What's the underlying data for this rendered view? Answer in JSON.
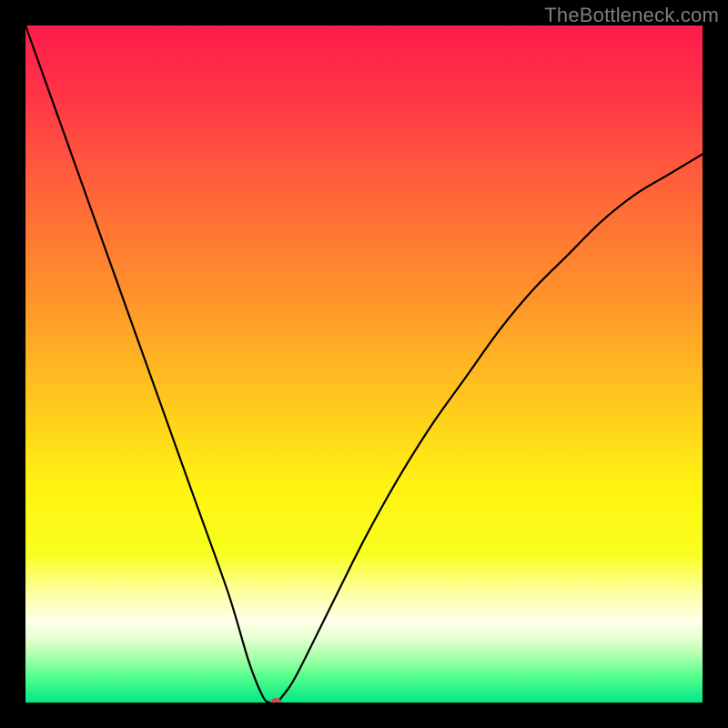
{
  "watermark": "TheBottleneck.com",
  "chart_data": {
    "type": "line",
    "title": "",
    "xlabel": "",
    "ylabel": "",
    "xlim": [
      0,
      100
    ],
    "ylim": [
      0,
      100
    ],
    "grid": false,
    "legend": false,
    "series": [
      {
        "name": "curve",
        "color": "#000000",
        "x": [
          0,
          5,
          10,
          15,
          20,
          25,
          30,
          33,
          35,
          36,
          37,
          38,
          40,
          45,
          50,
          55,
          60,
          65,
          70,
          75,
          80,
          85,
          90,
          95,
          100
        ],
        "y": [
          100,
          86,
          72,
          58,
          44,
          30,
          16,
          6,
          1,
          0,
          0,
          1,
          4,
          14,
          24,
          33,
          41,
          48,
          55,
          61,
          66,
          71,
          75,
          78,
          81
        ]
      }
    ],
    "marker": {
      "x": 37,
      "y": 0,
      "color": "#cc4f4f",
      "rx": 6,
      "ry": 5
    },
    "background_gradient": {
      "stops": [
        {
          "offset": 0.0,
          "color": "#ff1b4b"
        },
        {
          "offset": 0.1,
          "color": "#ff3447"
        },
        {
          "offset": 0.25,
          "color": "#ff6638"
        },
        {
          "offset": 0.4,
          "color": "#ff932b"
        },
        {
          "offset": 0.55,
          "color": "#ffc61e"
        },
        {
          "offset": 0.68,
          "color": "#fff312"
        },
        {
          "offset": 0.78,
          "color": "#f8ff1e"
        },
        {
          "offset": 0.84,
          "color": "#feffa8"
        },
        {
          "offset": 0.88,
          "color": "#ffffe9"
        },
        {
          "offset": 0.905,
          "color": "#e7ffd2"
        },
        {
          "offset": 0.93,
          "color": "#b0ffae"
        },
        {
          "offset": 0.96,
          "color": "#58ff8e"
        },
        {
          "offset": 1.0,
          "color": "#00e885"
        }
      ]
    }
  }
}
